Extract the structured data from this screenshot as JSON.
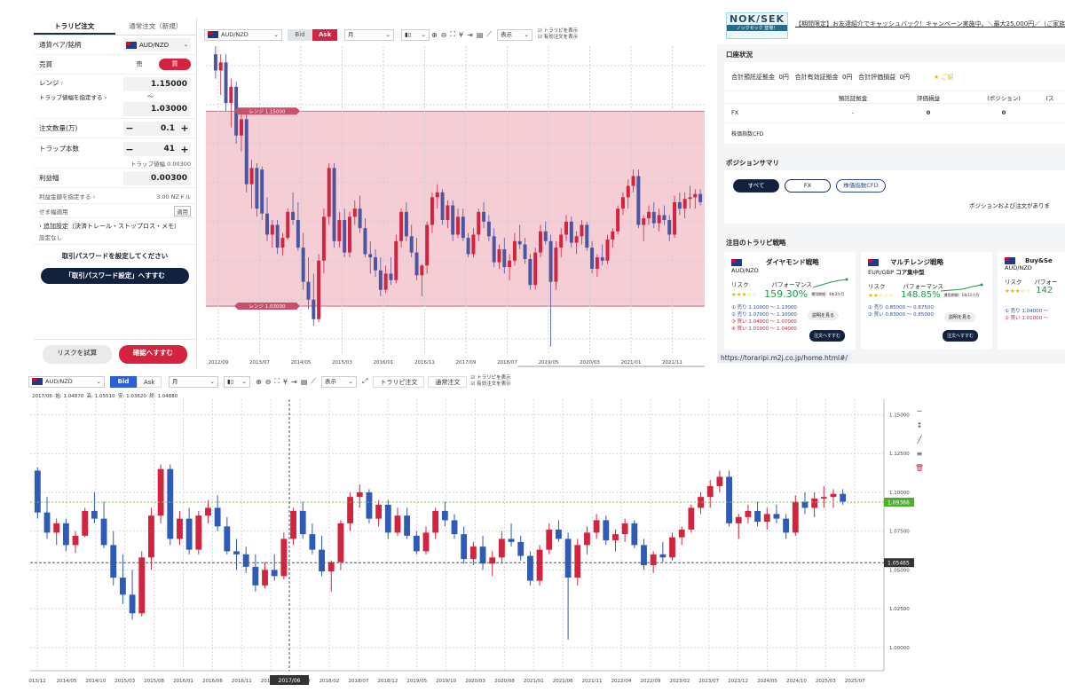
{
  "order_panel": {
    "tabs": [
      "トラリピ注文",
      "通常注文（新規）"
    ],
    "pair_label": "通貨ペア/銘柄",
    "pair_value": "AUD/NZD",
    "side_label": "売買",
    "sell_label": "売",
    "buy_label": "買",
    "range_label": "レンジ",
    "range_high": "1.15000",
    "trap_width_link": "トラップ値幅を指定する",
    "tilde": "〜",
    "range_low": "1.03000",
    "qty_label": "注文数量(万)",
    "qty_value": "0.1",
    "traps_label": "トラップ本数",
    "traps_value": "41",
    "trap_width_note": "トラップ値幅 0.00300",
    "profit_label": "利益幅",
    "profit_value": "0.00300",
    "profit_amount_link": "利益金額を指定する",
    "profit_amount_value": "3.00 NZドル",
    "setback_label": "せま幅適用",
    "setback_tag": "適用",
    "advanced_label": "追加設定（決済トレール・ストップロス・メモ）",
    "advanced_value": "設定なし",
    "password_note": "取引パスワードを設定してください",
    "password_button": "「取引パスワード設定」へすすむ",
    "risk_button": "リスクを試算",
    "confirm_button": "確認へすすむ"
  },
  "top_chart": {
    "pair": "AUD/NZD",
    "bid": "Bid",
    "ask": "Ask",
    "period": "月",
    "display": "表示",
    "check1": "トラリピを表示",
    "check2": "有効注文を表示",
    "range_high_tag": "レンジ 1.15000",
    "range_low_tag": "レンジ 1.03000",
    "x_labels": [
      "2012/09",
      "2013/07",
      "2014/05",
      "2015/03",
      "2016/01",
      "2016/11",
      "2017/09",
      "2018/07",
      "2019/05",
      "2020/03",
      "2021/01",
      "2021/11"
    ]
  },
  "bottom_chart": {
    "pair": "AUD/NZD",
    "bid": "Bid",
    "ask": "Ask",
    "period": "月",
    "display": "表示",
    "trarip_btn": "トラリピ注文",
    "normal_btn": "通常注文",
    "check1": "トラリピを表示",
    "check2": "有効注文を表示",
    "ohlc": "2017/06  始: 1.04870  高: 1.05510  安: 1.03620  終: 1.04880",
    "y_labels": [
      "1.15000",
      "1.12500",
      "1.10000",
      "1.07500",
      "1.05000",
      "1.02500",
      "1.00000"
    ],
    "current_tag": "1.09366",
    "cursor_tag": "1.05465",
    "cursor_date": "2017/06",
    "x_labels": [
      "013/12",
      "2014/05",
      "2014/10",
      "2015/03",
      "2015/08",
      "2016/01",
      "2016/06",
      "2016/11",
      "2017/04",
      "2017/09",
      "2018/02",
      "2018/07",
      "2018/12",
      "2019/05",
      "2019/10",
      "2020/03",
      "2020/08",
      "2021/01",
      "2021/06",
      "2021/11",
      "2022/04",
      "2022/09",
      "2023/02",
      "2023/07",
      "2023/12",
      "2024/05",
      "2024/10",
      "2025/03",
      "2025/07"
    ],
    "candles": [
      [
        1.114,
        1.116,
        1.083,
        1.087
      ],
      [
        1.087,
        1.097,
        1.07,
        1.074
      ],
      [
        1.074,
        1.083,
        1.066,
        1.08
      ],
      [
        1.08,
        1.083,
        1.062,
        1.066
      ],
      [
        1.066,
        1.075,
        1.061,
        1.072
      ],
      [
        1.072,
        1.09,
        1.071,
        1.088
      ],
      [
        1.088,
        1.1,
        1.08,
        1.083
      ],
      [
        1.083,
        1.094,
        1.064,
        1.066
      ],
      [
        1.066,
        1.075,
        1.04,
        1.045
      ],
      [
        1.045,
        1.06,
        1.028,
        1.034
      ],
      [
        1.034,
        1.05,
        1.018,
        1.022
      ],
      [
        1.022,
        1.062,
        1.02,
        1.058
      ],
      [
        1.058,
        1.09,
        1.05,
        1.085
      ],
      [
        1.085,
        1.118,
        1.08,
        1.115
      ],
      [
        1.115,
        1.118,
        1.066,
        1.07
      ],
      [
        1.07,
        1.088,
        1.066,
        1.083
      ],
      [
        1.083,
        1.09,
        1.06,
        1.063
      ],
      [
        1.063,
        1.088,
        1.06,
        1.085
      ],
      [
        1.085,
        1.095,
        1.08,
        1.09
      ],
      [
        1.09,
        1.098,
        1.075,
        1.078
      ],
      [
        1.078,
        1.084,
        1.06,
        1.062
      ],
      [
        1.062,
        1.07,
        1.05,
        1.06
      ],
      [
        1.06,
        1.065,
        1.048,
        1.052
      ],
      [
        1.052,
        1.06,
        1.036,
        1.04
      ],
      [
        1.04,
        1.055,
        1.038,
        1.05
      ],
      [
        1.05,
        1.06,
        1.043,
        1.046
      ],
      [
        1.046,
        1.074,
        1.044,
        1.07
      ],
      [
        1.07,
        1.09,
        1.066,
        1.088
      ],
      [
        1.088,
        1.094,
        1.07,
        1.073
      ],
      [
        1.073,
        1.08,
        1.06,
        1.063
      ],
      [
        1.063,
        1.072,
        1.046,
        1.049
      ],
      [
        1.049,
        1.056,
        1.036,
        1.055
      ],
      [
        1.055,
        1.082,
        1.05,
        1.08
      ],
      [
        1.08,
        1.1,
        1.075,
        1.097
      ],
      [
        1.097,
        1.105,
        1.09,
        1.1
      ],
      [
        1.1,
        1.102,
        1.08,
        1.083
      ],
      [
        1.083,
        1.095,
        1.078,
        1.092
      ],
      [
        1.092,
        1.095,
        1.07,
        1.074
      ],
      [
        1.074,
        1.09,
        1.072,
        1.085
      ],
      [
        1.085,
        1.09,
        1.07,
        1.072
      ],
      [
        1.072,
        1.075,
        1.06,
        1.062
      ],
      [
        1.062,
        1.078,
        1.06,
        1.074
      ],
      [
        1.074,
        1.09,
        1.07,
        1.088
      ],
      [
        1.088,
        1.094,
        1.078,
        1.082
      ],
      [
        1.082,
        1.086,
        1.07,
        1.073
      ],
      [
        1.073,
        1.078,
        1.054,
        1.057
      ],
      [
        1.057,
        1.068,
        1.053,
        1.065
      ],
      [
        1.065,
        1.072,
        1.05,
        1.054
      ],
      [
        1.054,
        1.062,
        1.046,
        1.058
      ],
      [
        1.058,
        1.075,
        1.055,
        1.07
      ],
      [
        1.07,
        1.08,
        1.065,
        1.068
      ],
      [
        1.068,
        1.072,
        1.056,
        1.059
      ],
      [
        1.059,
        1.062,
        1.04,
        1.043
      ],
      [
        1.043,
        1.066,
        1.04,
        1.063
      ],
      [
        1.063,
        1.08,
        1.06,
        1.076
      ],
      [
        1.076,
        1.082,
        1.068,
        1.07
      ],
      [
        1.07,
        1.074,
        1.005,
        1.045
      ],
      [
        1.045,
        1.07,
        1.04,
        1.066
      ],
      [
        1.066,
        1.078,
        1.06,
        1.074
      ],
      [
        1.074,
        1.086,
        1.07,
        1.082
      ],
      [
        1.082,
        1.085,
        1.066,
        1.069
      ],
      [
        1.069,
        1.076,
        1.062,
        1.073
      ],
      [
        1.073,
        1.083,
        1.068,
        1.08
      ],
      [
        1.08,
        1.082,
        1.064,
        1.066
      ],
      [
        1.066,
        1.07,
        1.05,
        1.053
      ],
      [
        1.053,
        1.062,
        1.048,
        1.06
      ],
      [
        1.06,
        1.068,
        1.055,
        1.058
      ],
      [
        1.058,
        1.074,
        1.056,
        1.071
      ],
      [
        1.071,
        1.078,
        1.066,
        1.076
      ],
      [
        1.076,
        1.092,
        1.074,
        1.09
      ],
      [
        1.09,
        1.1,
        1.086,
        1.097
      ],
      [
        1.097,
        1.108,
        1.09,
        1.104
      ],
      [
        1.104,
        1.114,
        1.1,
        1.11
      ],
      [
        1.11,
        1.114,
        1.078,
        1.08
      ],
      [
        1.08,
        1.086,
        1.07,
        1.084
      ],
      [
        1.084,
        1.092,
        1.08,
        1.088
      ],
      [
        1.088,
        1.094,
        1.078,
        1.081
      ],
      [
        1.081,
        1.09,
        1.076,
        1.086
      ],
      [
        1.086,
        1.092,
        1.08,
        1.083
      ],
      [
        1.083,
        1.086,
        1.07,
        1.074
      ],
      [
        1.074,
        1.098,
        1.072,
        1.094
      ],
      [
        1.094,
        1.1,
        1.086,
        1.09
      ],
      [
        1.09,
        1.1,
        1.084,
        1.096
      ],
      [
        1.096,
        1.104,
        1.09,
        1.097
      ],
      [
        1.097,
        1.102,
        1.09,
        1.099
      ],
      [
        1.099,
        1.102,
        1.092,
        1.094
      ]
    ]
  },
  "account_panel": {
    "banner_logo": "NOK/SEK",
    "banner_logo_sub": "ノックセック 登場！",
    "banner_text": "【期間限定】お友達紹介でキャッシュバック！キャンペーン実施中。＼最大25,000円／（ご家族もボ",
    "status_title": "口座状況",
    "summary": "合計預託証拠金  0円   合計有効証拠金  0円   合計評価損益  0円",
    "stars_label": "★ ご紹",
    "table_headers": [
      "預託証拠金",
      "評価損益",
      "(ポジション)",
      "(ス"
    ],
    "row_fx": [
      "FX",
      "-",
      "0",
      "0"
    ],
    "row_cfd": "株価指数CFD",
    "pos_title": "ポジションサマリ",
    "pos_tabs": [
      "すべて",
      "FX",
      "株価指数CFD"
    ],
    "pos_empty": "ポジションおよび注文がありま",
    "strat_title": "注目のトラリピ戦略",
    "strategies": [
      {
        "name": "ダイヤモンド戦略",
        "pair": "AUD/NZD",
        "risk": "リスク",
        "perf_label": "パフォーマンス",
        "perf": "159.30%",
        "period": "運用期間：4年3か月",
        "detail": "説明を見る",
        "orders": [
          "① 売り 1.10000 〜 1.13000",
          "② 売り 1.07000 〜 1.10000",
          "③ 買い 1.04000 〜 1.07000",
          "④ 買い 1.01000 〜 1.04000"
        ],
        "go": "注文へすすむ"
      },
      {
        "name": "マルチレンジ戦略",
        "pair": "EUR/GBP",
        "sub": "コア集中型",
        "risk": "リスク",
        "perf_label": "パフォーマンス",
        "perf": "148.85%",
        "period": "運用期間：1年11カ月",
        "detail": "説明を見る",
        "orders": [
          "① 売り 0.85000 〜 0.87500",
          "② 買い 0.83000 〜 0.85000"
        ],
        "go": "注文へすすむ"
      },
      {
        "name": "Buy&Se",
        "pair": "AUD/NZD",
        "risk": "リスク",
        "perf_label": "パフォー",
        "perf": "142",
        "orders": [
          "① 売り 1.04000 〜",
          "② 買い 1.01000 〜"
        ]
      }
    ],
    "url": "https://toraripi.m2j.co.jp/home.html#/"
  }
}
